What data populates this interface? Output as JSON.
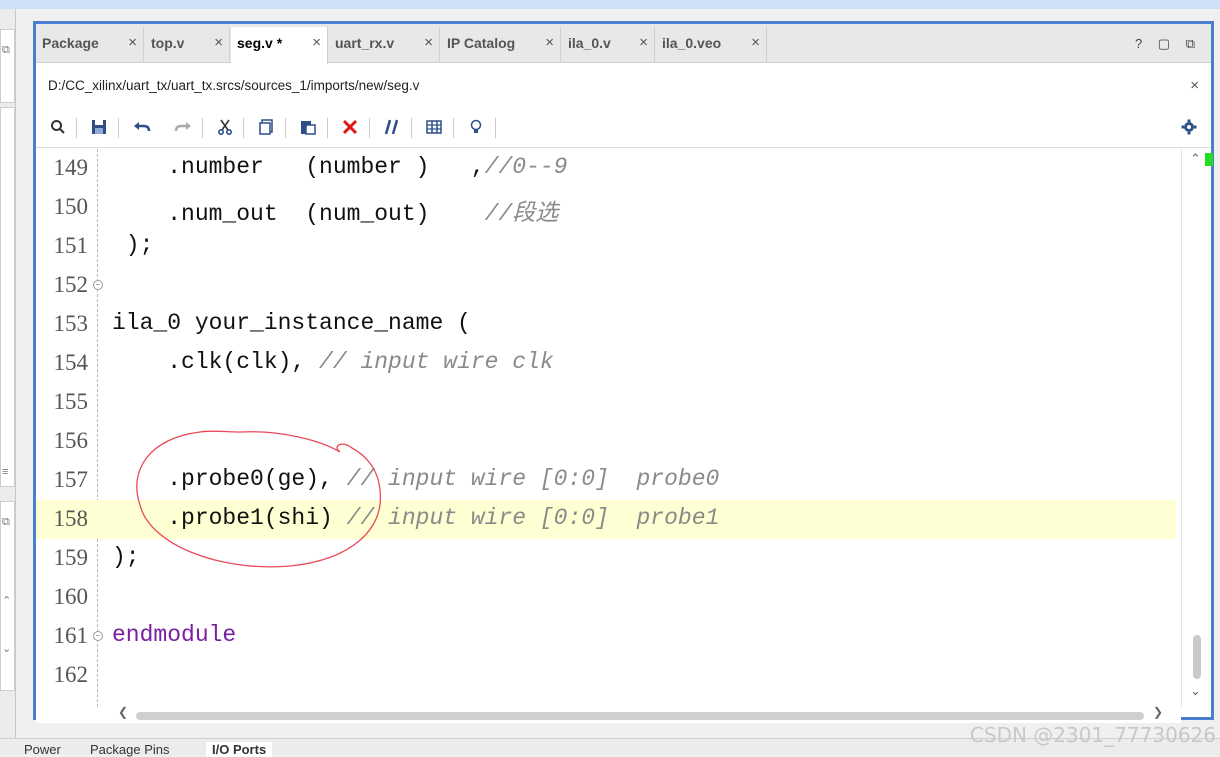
{
  "tabs": [
    {
      "label": "Package",
      "close": "×"
    },
    {
      "label": "top.v",
      "close": "×"
    },
    {
      "label": "seg.v *",
      "close": "×",
      "active": true
    },
    {
      "label": "uart_rx.v",
      "close": "×"
    },
    {
      "label": "IP Catalog",
      "close": "×"
    },
    {
      "label": "ila_0.v",
      "close": "×"
    },
    {
      "label": "ila_0.veo",
      "close": "×"
    }
  ],
  "tab_tools": "? ▢ ⧉",
  "path": {
    "text": "D:/CC_xilinx/uart_tx/uart_tx.srcs/sources_1/imports/new/seg.v",
    "close": "×"
  },
  "toolbar_icons": [
    "search-icon",
    "save-icon",
    "undo-icon",
    "redo-icon",
    "cut-icon",
    "copy-icon",
    "paste-icon",
    "delete-icon",
    "comment-icon",
    "column-icon",
    "hint-icon",
    "settings-icon"
  ],
  "code_lines": [
    {
      "num": "149",
      "code": "    .number   (number )   ,",
      "comment": "//0--9"
    },
    {
      "num": "150",
      "code": "    .num_out  (num_out)    ",
      "comment": "//段选"
    },
    {
      "num": "151",
      "code": " );",
      "comment": ""
    },
    {
      "num": "152",
      "code": "",
      "comment": "",
      "fold": true
    },
    {
      "num": "153",
      "code": "ila_0 your_instance_name (",
      "comment": ""
    },
    {
      "num": "154",
      "code": "    .clk(clk), ",
      "comment": "// input wire clk"
    },
    {
      "num": "155",
      "code": "",
      "comment": ""
    },
    {
      "num": "156",
      "code": "",
      "comment": ""
    },
    {
      "num": "157",
      "code": "    .probe0(ge), ",
      "comment": "// input wire [0:0]  probe0"
    },
    {
      "num": "158",
      "code": "    .probe1(shi) ",
      "comment": "// input wire [0:0]  probe1",
      "highlight": true
    },
    {
      "num": "159",
      "code": ");",
      "comment": ""
    },
    {
      "num": "160",
      "code": "",
      "comment": ""
    },
    {
      "num": "161",
      "code": "",
      "keyword": "endmodule",
      "comment": "",
      "fold": true
    },
    {
      "num": "162",
      "code": "",
      "comment": ""
    }
  ],
  "bottom_tabs": [
    "Power",
    "Package Pins",
    "I/O Ports"
  ],
  "watermark": "CSDN @2301_77730626",
  "colors": {
    "frame_border": "#4a7fcf",
    "highlight": "#ffffd4",
    "keyword": "#7a1fa2",
    "comment": "#8a8a8a",
    "annotation": "#e84a5a"
  }
}
